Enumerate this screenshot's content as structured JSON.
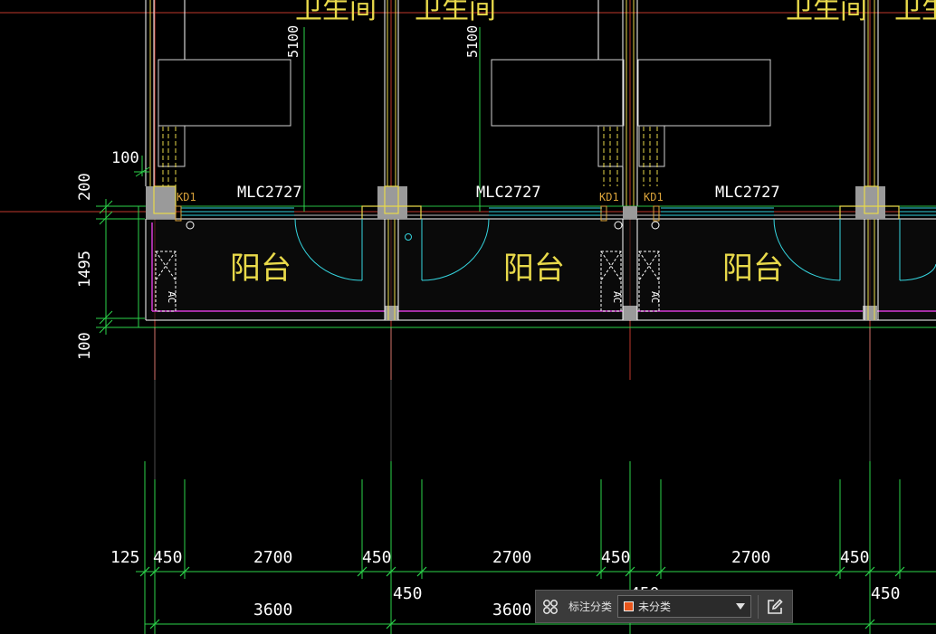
{
  "drawing": {
    "room_label": "阳台",
    "top_room_label": "卫生间",
    "door_tag": "MLC2727",
    "kd_tag": "KD1",
    "ac_tag": "AC",
    "vertical_dims": {
      "d200": "200",
      "d1495": "1495",
      "d100_top": "100",
      "d100_bottom": "100"
    },
    "top_dims": {
      "left": "5100",
      "mid": "5100"
    },
    "bottom_row1": [
      "125",
      "450",
      "2700",
      "450",
      "2700",
      "450",
      "2700",
      "450"
    ],
    "bottom_row2": [
      "3600",
      "450",
      "3600",
      "450",
      "450"
    ],
    "colors": {
      "wall": "#ffffff",
      "yellow": "#e8d94a",
      "cyan": "#35d6e0",
      "green": "#2bd34a",
      "red": "#c0392b",
      "magenta": "#d63bd6",
      "column": "#9a9a9a",
      "kd": "#d9a23a"
    }
  },
  "toolbar": {
    "grid_icon": "grid-icon",
    "label": "标注分类",
    "category_value": "未分类",
    "swatch_color": "#e8561c",
    "dropdown_icon": "chevron-down-icon",
    "edit_icon": "edit-icon"
  }
}
